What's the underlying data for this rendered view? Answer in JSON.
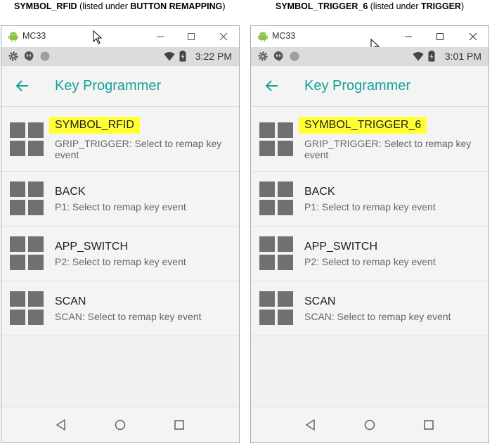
{
  "captions": [
    {
      "main": "SYMBOL_RFID",
      "mid": " (listed under ",
      "bold": "BUTTON REMAPPING",
      "end": ")"
    },
    {
      "main": "SYMBOL_TRIGGER_6",
      "mid": " (listed under ",
      "bold": "TRIGGER",
      "end": ")"
    }
  ],
  "panels": [
    {
      "window_title": "MC33",
      "time": "3:22 PM",
      "app_title": "Key Programmer",
      "items": [
        {
          "title": "SYMBOL_RFID",
          "subtitle": "GRIP_TRIGGER: Select to remap key event",
          "highlighted": true
        },
        {
          "title": "BACK",
          "subtitle": "P1: Select to remap key event"
        },
        {
          "title": "APP_SWITCH",
          "subtitle": "P2: Select to remap key event"
        },
        {
          "title": "SCAN",
          "subtitle": "SCAN: Select to remap key event"
        }
      ]
    },
    {
      "window_title": "MC33",
      "time": "3:01 PM",
      "app_title": "Key Programmer",
      "items": [
        {
          "title": "SYMBOL_TRIGGER_6",
          "subtitle": "GRIP_TRIGGER: Select to remap key event",
          "highlighted": true
        },
        {
          "title": "BACK",
          "subtitle": "P1: Select to remap key event"
        },
        {
          "title": "APP_SWITCH",
          "subtitle": "P2: Select to remap key event"
        },
        {
          "title": "SCAN",
          "subtitle": "SCAN: Select to remap key event"
        }
      ]
    }
  ],
  "colors": {
    "accent": "#16a197",
    "highlight": "#ffff33",
    "icon_gray": "#707070"
  },
  "icons": [
    "android-icon",
    "gear-icon",
    "hangouts-icon",
    "circle-icon",
    "wifi-icon",
    "battery-icon",
    "back-arrow-icon",
    "grid-icon",
    "nav-back-icon",
    "nav-home-icon",
    "nav-recents-icon"
  ]
}
